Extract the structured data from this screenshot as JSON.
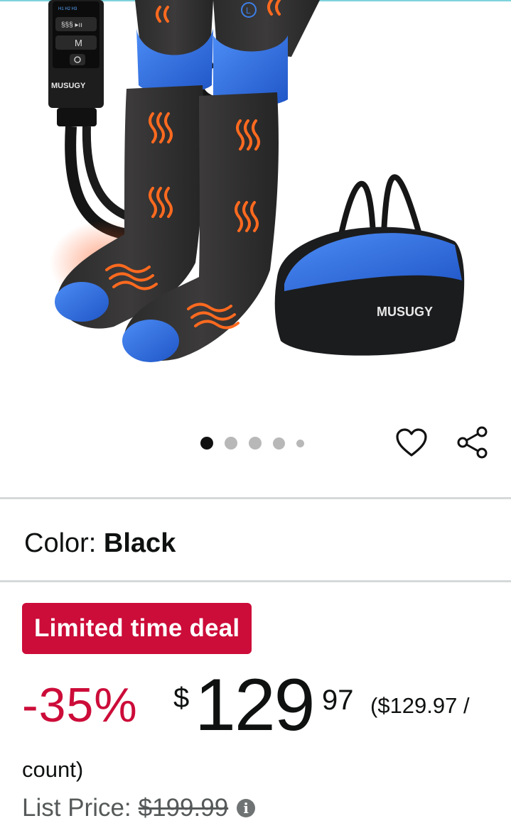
{
  "product": {
    "image_alt": "MUSUGY leg compression massager with carrying bag",
    "brand_mark": "MUSUGY",
    "controller_keys": {
      "mode": "M"
    },
    "image_count": 5,
    "active_image_index": 0
  },
  "actions": {
    "favorite_icon": "heart-icon",
    "share_icon": "share-icon"
  },
  "color": {
    "label": "Color: ",
    "value": "Black"
  },
  "deal": {
    "badge": "Limited time deal",
    "badge_color": "#cc0c39"
  },
  "price": {
    "discount": "-35%",
    "currency": "$",
    "whole": "129",
    "fraction": "97",
    "unit_price_line1": "($129.97 /",
    "unit_price_line2": "count)",
    "list_price_label": "List Price:",
    "list_price_value": "$199.99",
    "info_icon": "info-icon"
  },
  "colors": {
    "accent_red": "#cc0c39",
    "text": "#0f1111",
    "muted": "#565959",
    "divider": "#d5d9d9",
    "product_blue": "#2f6fe0"
  }
}
